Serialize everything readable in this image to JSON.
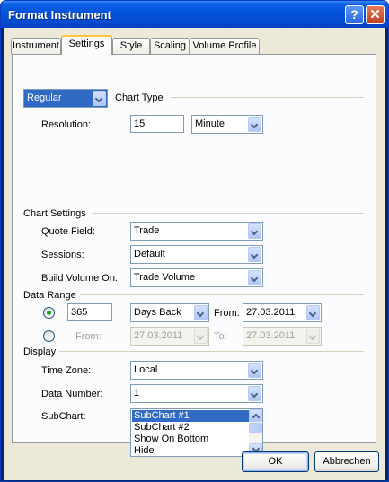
{
  "window": {
    "title": "Format Instrument"
  },
  "tabs": [
    {
      "label": "Instrument",
      "active": false
    },
    {
      "label": "Settings",
      "active": true
    },
    {
      "label": "Style",
      "active": false
    },
    {
      "label": "Scaling",
      "active": false
    },
    {
      "label": "Volume Profile",
      "active": false
    }
  ],
  "chart_type": {
    "selected": "Regular",
    "label": "Chart Type",
    "resolution_label": "Resolution:",
    "resolution_value": "15",
    "resolution_unit": "Minute"
  },
  "chart_settings": {
    "header": "Chart Settings",
    "quote_field_label": "Quote Field:",
    "quote_field_value": "Trade",
    "sessions_label": "Sessions:",
    "sessions_value": "Default",
    "build_volume_label": "Build Volume On:",
    "build_volume_value": "Trade Volume"
  },
  "data_range": {
    "header": "Data Range",
    "days_value": "365",
    "days_mode": "Days Back",
    "from_label": "From:",
    "from_date": "27.03.2011",
    "alt_from_label": "From:",
    "alt_from_date": "27.03.2011",
    "alt_to_label": "To:",
    "alt_to_date": "27.03.2011"
  },
  "display": {
    "header": "Display",
    "time_zone_label": "Time Zone:",
    "time_zone_value": "Local",
    "data_number_label": "Data Number:",
    "data_number_value": "1",
    "subchart_label": "SubChart:",
    "subchart_items": [
      "SubChart #1",
      "SubChart #2",
      "Show On Bottom",
      "Hide"
    ]
  },
  "buttons": {
    "ok": "OK",
    "cancel": "Abbrechen"
  },
  "colors": {
    "titlebar": "#0453d8",
    "face": "#ece9d8",
    "selection": "#316ac5",
    "radio_dot": "#21a121"
  }
}
